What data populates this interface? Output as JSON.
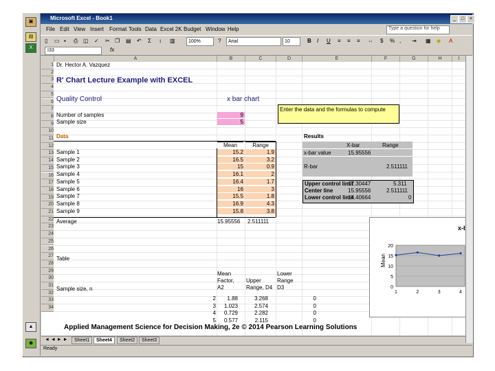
{
  "window": {
    "title": "Microsoft Excel - Book1"
  },
  "menu": [
    "File",
    "Edit",
    "View",
    "Insert",
    "Format",
    "Tools",
    "Data",
    "Excel 2K",
    "Budget",
    "Window",
    "Help"
  ],
  "help_box": {
    "placeholder": "Type a question for help"
  },
  "toolbar": {
    "zoom": "100%",
    "font": "Arial",
    "size": "10"
  },
  "formula_bar": {
    "name_box": "I33",
    "fx": "fx"
  },
  "columns": [
    "A",
    "B",
    "C",
    "D",
    "E",
    "F",
    "G",
    "H",
    "I"
  ],
  "rows": [
    "1",
    "2",
    "3",
    "4",
    "5",
    "6",
    "7",
    "8",
    "9",
    "10",
    "11",
    "12",
    "13",
    "14",
    "15",
    "16",
    "17",
    "18",
    "19",
    "20",
    "21",
    "22",
    "23",
    "24",
    "25",
    "26",
    "27",
    "28",
    "29",
    "30",
    "31",
    "32",
    "33",
    "34"
  ],
  "sheet": {
    "author": "Dr. Hector A. Vazquez",
    "title": "R' Chart Lecture Example with EXCEL",
    "quality_control": "Quality Control",
    "xbar_chart": "x bar chart",
    "num_samples_label": "Number of samples",
    "num_samples": "9",
    "sample_size_label": "Sample size",
    "sample_size": "5",
    "note": "Enter the data and the formulas to compute",
    "data_label": "Data",
    "results_label": "Results",
    "mean_header": "Mean",
    "range_header": "Range",
    "samples": [
      {
        "label": "Sample 1",
        "mean": "15.2",
        "range": "1.9"
      },
      {
        "label": "Sample 2",
        "mean": "16.5",
        "range": "3.2"
      },
      {
        "label": "Sample 3",
        "mean": "15",
        "range": "0.9"
      },
      {
        "label": "Sample 4",
        "mean": "16.1",
        "range": "2"
      },
      {
        "label": "Sample 5",
        "mean": "16.4",
        "range": "1.7"
      },
      {
        "label": "Sample 6",
        "mean": "16",
        "range": "3"
      },
      {
        "label": "Sample 7",
        "mean": "15.5",
        "range": "1.8"
      },
      {
        "label": "Sample 8",
        "mean": "16.9",
        "range": "4.3"
      },
      {
        "label": "Sample 9",
        "mean": "15.8",
        "range": "3.8"
      }
    ],
    "average_label": "Average",
    "average_mean": "15.95556",
    "average_range": "2.511111",
    "results": {
      "header_xbar": "X-bar",
      "header_range": "Range",
      "xbar_value_label": "x-bar value",
      "xbar_value": "15.95556",
      "rbar_label": "R-bar",
      "rbar_value": "2.511111",
      "ucl_label": "Upper control limit",
      "ucl_xbar": "17.30447",
      "ucl_range": "5.311",
      "cl_label": "Center line",
      "cl_xbar": "15.95556",
      "cl_range": "2.511111",
      "lcl_label": "Lower control limit",
      "lcl_xbar": "14.40664",
      "lcl_range": "0"
    },
    "table_label": "Table",
    "table_headers": [
      "Sample size, n",
      "Mean Factor, A2",
      "Upper Range, D4",
      "Lower Range D3"
    ],
    "table_rows": [
      [
        "2",
        "1.88",
        "3.268",
        "0"
      ],
      [
        "3",
        "1.023",
        "2.574",
        "0"
      ],
      [
        "4",
        "0.729",
        "2.282",
        "0"
      ],
      [
        "5",
        "0.577",
        "2.115",
        "0"
      ]
    ]
  },
  "chart_data": {
    "type": "line",
    "title": "x-b",
    "ylabel": "Mean",
    "x": [
      1,
      2,
      3,
      4
    ],
    "yticks": [
      "0",
      "5",
      "10",
      "15",
      "20"
    ],
    "ylim": [
      0,
      20
    ],
    "series": [
      {
        "name": "",
        "values": [
          15.2,
          16.5,
          15,
          16.1
        ]
      }
    ],
    "grid": true
  },
  "sheet_tabs": [
    "Sheet1",
    "Sheet4",
    "Sheet2",
    "Sheet3"
  ],
  "status": "Ready",
  "footer": "Applied Management Science for Decision Making, 2e © 2014 Pearson Learning Solutions"
}
